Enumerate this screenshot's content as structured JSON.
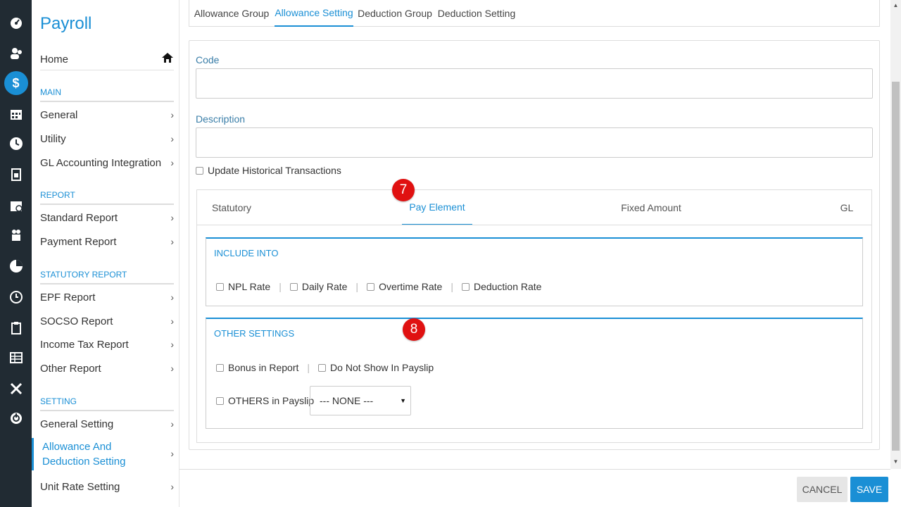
{
  "rail": {
    "icons": [
      {
        "name": "dashboard-icon",
        "glyph": "◔"
      },
      {
        "name": "people-icon",
        "glyph": "👥"
      },
      {
        "name": "payroll-dollar-icon",
        "glyph": "$"
      },
      {
        "name": "calendar-icon",
        "glyph": "▦"
      },
      {
        "name": "clock-icon",
        "glyph": "●"
      },
      {
        "name": "document-icon",
        "glyph": "▤"
      },
      {
        "name": "calendar-check-icon",
        "glyph": "▣"
      },
      {
        "name": "gift-icon",
        "glyph": "✚"
      },
      {
        "name": "pie-chart-icon",
        "glyph": "◕"
      },
      {
        "name": "timer-icon",
        "glyph": "◴"
      },
      {
        "name": "clipboard-icon",
        "glyph": "▥"
      },
      {
        "name": "table-icon",
        "glyph": "▦"
      },
      {
        "name": "tools-icon",
        "glyph": "✕"
      },
      {
        "name": "power-icon",
        "glyph": "⏻"
      }
    ]
  },
  "sidebar": {
    "title": "Payroll",
    "home": "Home",
    "sections": {
      "main": "MAIN",
      "report": "REPORT",
      "statutory": "STATUTORY REPORT",
      "setting": "SETTING"
    },
    "items": {
      "general": "General",
      "utility": "Utility",
      "gl_integration": "GL Accounting Integration",
      "standard_report": "Standard Report",
      "payment_report": "Payment Report",
      "epf_report": "EPF Report",
      "socso_report": "SOCSO Report",
      "income_tax_report": "Income Tax Report",
      "other_report": "Other Report",
      "general_setting": "General Setting",
      "allowance_deduction_setting": "Allowance And Deduction Setting",
      "unit_rate_setting": "Unit Rate Setting"
    },
    "chevron": "›"
  },
  "top_tabs": {
    "allowance_group": "Allowance Group",
    "allowance_setting": "Allowance Setting",
    "deduction_group": "Deduction Group",
    "deduction_setting": "Deduction Setting"
  },
  "form": {
    "code_label": "Code",
    "code_value": "",
    "description_label": "Description",
    "description_value": "",
    "update_historical": "Update Historical Transactions"
  },
  "inner_tabs": {
    "statutory": "Statutory",
    "pay_element": "Pay Element",
    "fixed_amount": "Fixed Amount",
    "gl": "GL"
  },
  "include_into": {
    "title": "INCLUDE INTO",
    "npl_rate": "NPL Rate",
    "daily_rate": "Daily Rate",
    "overtime_rate": "Overtime Rate",
    "deduction_rate": "Deduction Rate"
  },
  "other_settings": {
    "title": "OTHER SETTINGS",
    "bonus_in_report": "Bonus in Report",
    "do_not_show_in_payslip": "Do Not Show In Payslip",
    "others_in_payslip": "OTHERS in Payslip",
    "others_select_value": "--- NONE ---"
  },
  "badges": {
    "step7": "7",
    "step8": "8"
  },
  "footer": {
    "cancel": "CANCEL",
    "save": "SAVE"
  },
  "colors": {
    "accent": "#1a8fd5",
    "rail_bg": "#212b33",
    "badge": "#e01111"
  }
}
